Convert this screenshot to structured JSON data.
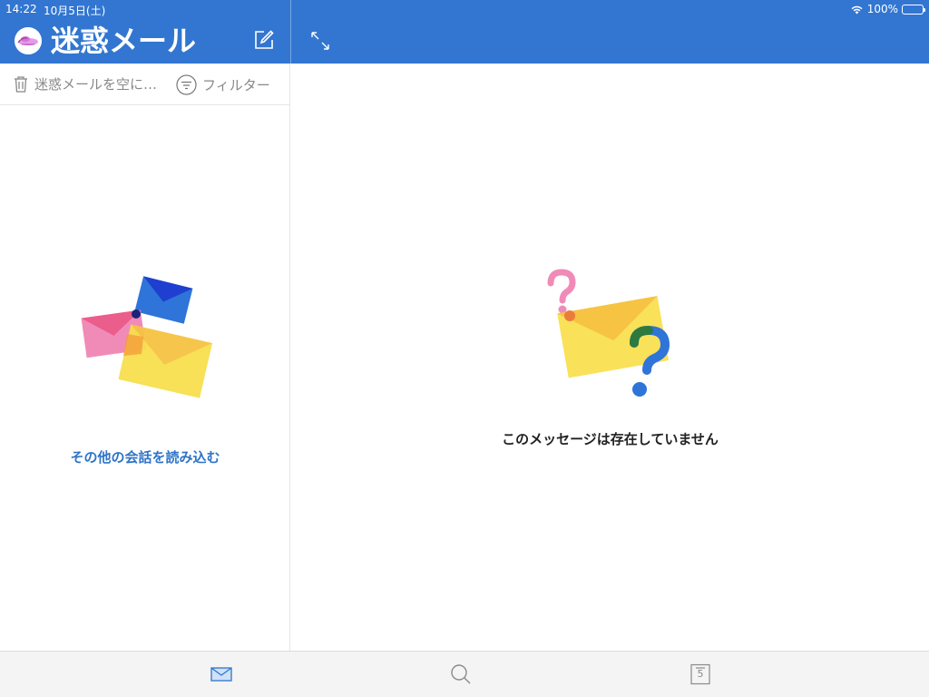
{
  "status": {
    "time": "14:22",
    "date": "10月5日(土)",
    "battery": "100%"
  },
  "header": {
    "title": "迷惑メール"
  },
  "toolbar": {
    "empty_label": "迷惑メールを空に…",
    "filter_label": "フィルター"
  },
  "list": {
    "load_more": "その他の会話を読み込む"
  },
  "reading": {
    "empty_message": "このメッセージは存在していません"
  },
  "tabs": {
    "calendar_day": "5"
  },
  "colors": {
    "accent": "#3276d1",
    "link": "#2f74c8"
  },
  "icons": [
    "compose-icon",
    "expand-icon",
    "trash-icon",
    "filter-icon",
    "mail-icon",
    "search-icon",
    "calendar-icon"
  ]
}
